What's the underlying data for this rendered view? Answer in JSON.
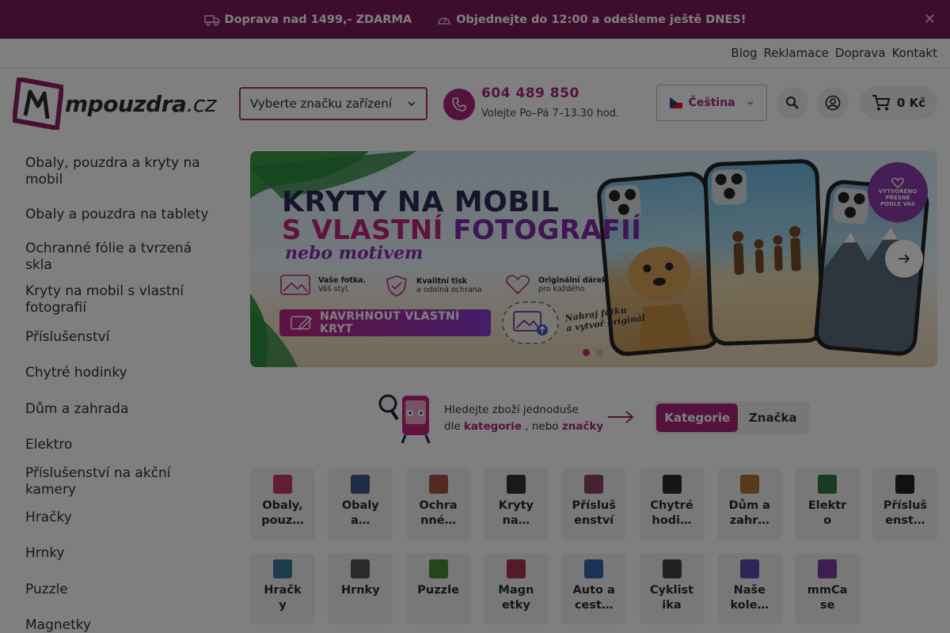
{
  "promo": {
    "shipping_text": "Doprava nad 1499,- ZDARMA",
    "dispatch_text": "Objednejte do 12:00 a odešleme ještě DNES!",
    "close_glyph": "✕",
    "bg": "#7a1a5a"
  },
  "toplinks": [
    "Blog",
    "Reklamace",
    "Doprava",
    "Kontakt"
  ],
  "header": {
    "logo_main": "mpouzdra",
    "logo_tld": ".cz",
    "brand_select": "Vyberte značku zařízení",
    "phone": "604 489 850",
    "hours": "Volejte Po–Pá 7–13.30 hod.",
    "language": "Čeština",
    "cart": "0 Kč",
    "accent": "#a8257a"
  },
  "sidebar": [
    "Obaly, pouzdra a kryty na mobil",
    "Obaly a pouzdra na tablety",
    "Ochranné fólie a tvrzená skla",
    "Kryty na mobil s vlastní fotografií",
    "Příslušenství",
    "Chytré hodinky",
    "Dům a zahrada",
    "Elektro",
    "Příslušenství na akční kamery",
    "Hračky",
    "Hrnky",
    "Puzzle",
    "Magnetky"
  ],
  "banner": {
    "line1": "KRYTY NA MOBIL",
    "line2_a": "S VLASTNÍ ",
    "line2_b": "FOTOGRAFIÍ",
    "line3": "nebo motivem",
    "features": [
      {
        "title": "Vaše fotka.",
        "sub": "Váš styl."
      },
      {
        "title": "Kvalitní tisk",
        "sub": "a odolná ochrana"
      },
      {
        "title": "Originální dárek",
        "sub": "pro každého"
      }
    ],
    "cta": "NAVRHNOUT VLASTNÍ KRYT",
    "note_line1": "Nahraj fotku",
    "note_line2": "a vytvoř originál",
    "stamp_line1": "VYTVOŘENO",
    "stamp_line2": "PŘESNĚ",
    "stamp_line3": "PODLE VÁS"
  },
  "helper": {
    "line1": "Hledejte zboží jednoduše",
    "line2_prefix": "dle ",
    "kategorie": "kategorie",
    "mid": " , nebo ",
    "znacky": "značky",
    "toggle_active": "Kategorie",
    "toggle_idle": "Značka"
  },
  "categories_row1": [
    {
      "line1": "Obaly,",
      "line2": "pouz…",
      "color": "#c23a6a"
    },
    {
      "line1": "Obaly",
      "line2": "a…",
      "color": "#3a5a8a"
    },
    {
      "line1": "Ochra",
      "line2": "nné…",
      "color": "#aa5544"
    },
    {
      "line1": "Kryty",
      "line2": "na…",
      "color": "#333333"
    },
    {
      "line1": "Přísluš",
      "line2": "enství",
      "color": "#884466"
    },
    {
      "line1": "Chytré",
      "line2": "hodi…",
      "color": "#2a2a2a"
    },
    {
      "line1": "Dům a",
      "line2": "zahr…",
      "color": "#aa7733"
    },
    {
      "line1": "Elektr",
      "line2": "o",
      "color": "#337744"
    },
    {
      "line1": "Přísluš",
      "line2": "enst…",
      "color": "#222222"
    }
  ],
  "categories_row2": [
    {
      "line1": "Hračk",
      "line2": "y",
      "color": "#3a7a9a"
    },
    {
      "line1": "Hrnky",
      "line2": "",
      "color": "#555555"
    },
    {
      "line1": "Puzzle",
      "line2": "",
      "color": "#4a8a3a"
    },
    {
      "line1": "Magn",
      "line2": "etky",
      "color": "#aa3355"
    },
    {
      "line1": "Auto a",
      "line2": "cest…",
      "color": "#3366aa"
    },
    {
      "line1": "Cyklist",
      "line2": "ika",
      "color": "#444444"
    },
    {
      "line1": "Naše",
      "line2": "kole…",
      "color": "#5a4aaa"
    },
    {
      "line1": "mmCa",
      "line2": "se",
      "color": "#7a3aa8"
    }
  ]
}
